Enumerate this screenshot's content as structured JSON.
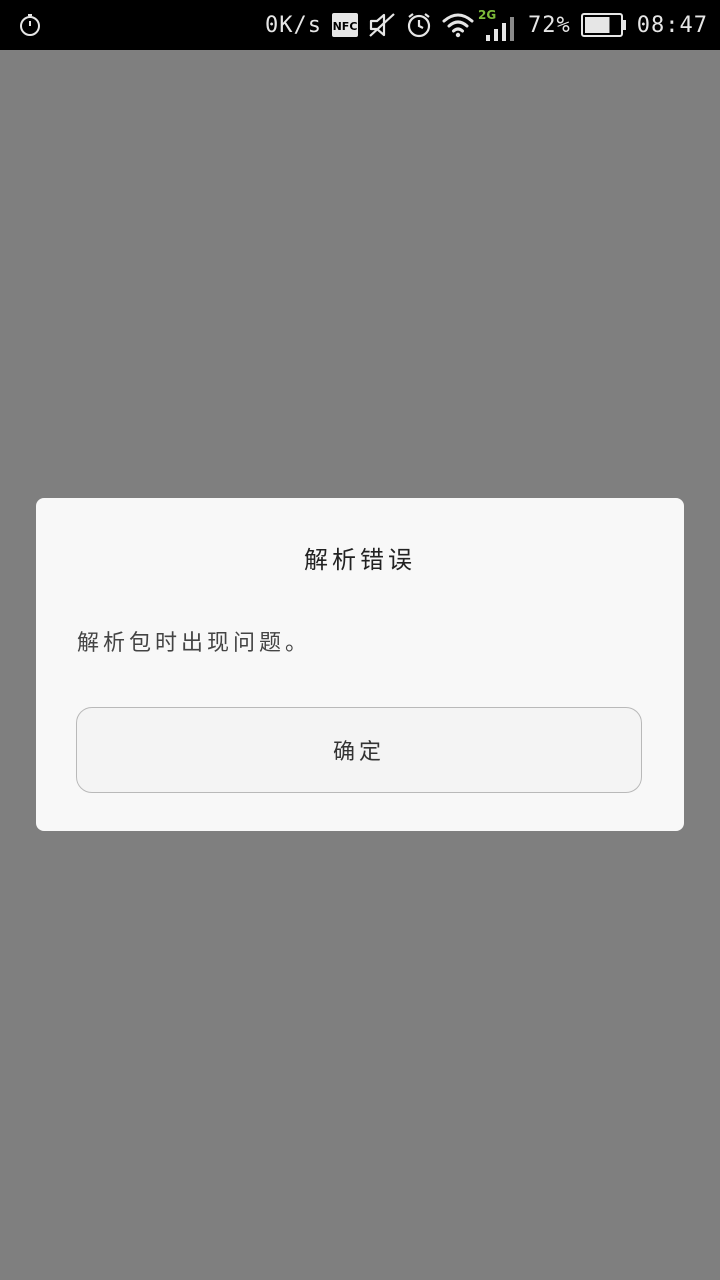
{
  "status_bar": {
    "speed": "0K/s",
    "nfc": "NFC",
    "network_type": "2G",
    "battery_percent": "72%",
    "battery_level": 0.72,
    "time": "08:47",
    "icons": [
      "stopwatch-icon",
      "nfc-icon",
      "silent-icon",
      "alarm-icon",
      "wifi-icon",
      "signal-icon",
      "battery-icon"
    ]
  },
  "dialog": {
    "title": "解析错误",
    "message": "解析包时出现问题。",
    "ok_label": "确定"
  },
  "colors": {
    "overlay": "#7f7f7f",
    "status_bar": "#000000",
    "dialog_bg": "#f8f8f8",
    "network_type": "#7dbb3a"
  }
}
